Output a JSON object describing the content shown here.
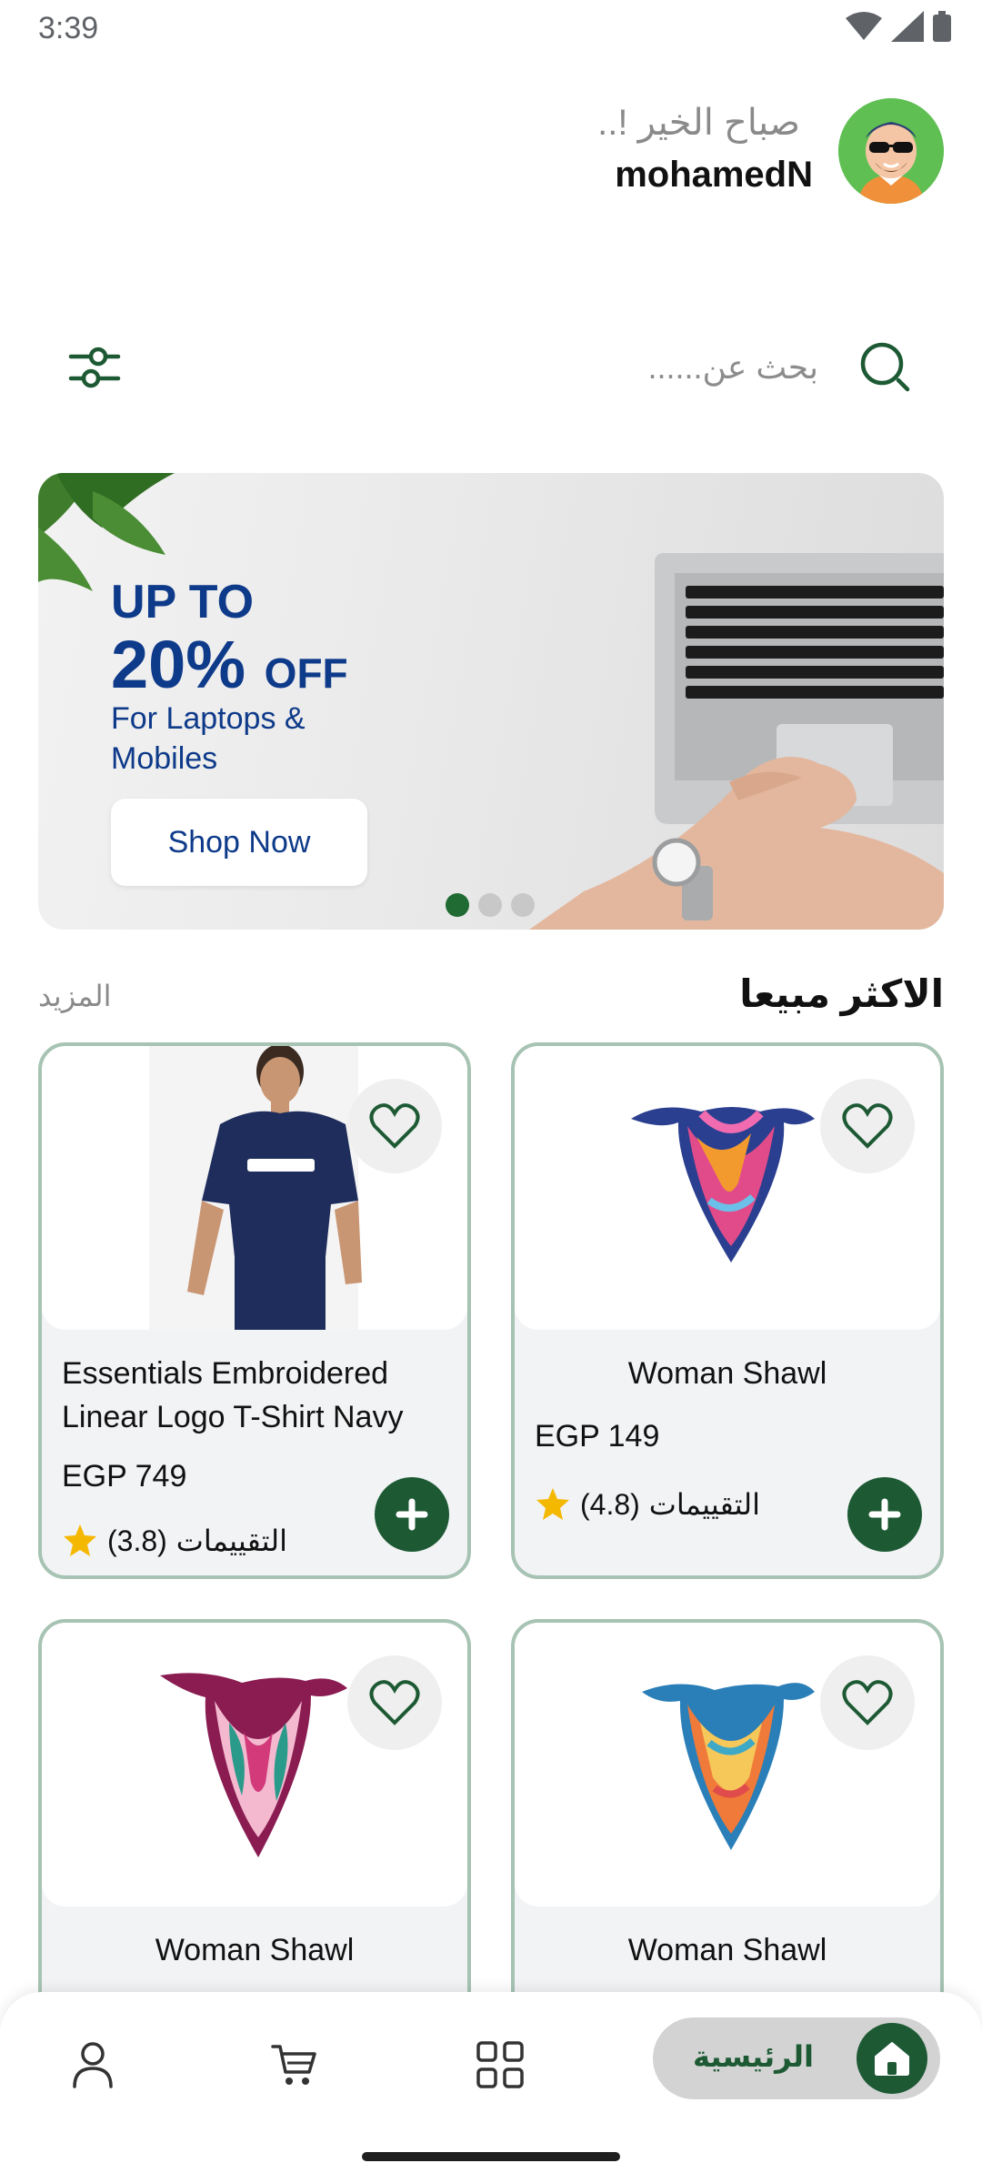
{
  "status_bar": {
    "time": "3:39"
  },
  "header": {
    "greeting": "صباح الخير !..",
    "username": "mohamedN"
  },
  "search": {
    "placeholder": "بحث عن......"
  },
  "banner": {
    "line1": "UP TO",
    "line2_percent": "20%",
    "line2_off": "OFF",
    "line3": "For Laptops & Mobiles",
    "button_label": "Shop Now",
    "slide_count": 3,
    "active_slide": 1
  },
  "section": {
    "title": "الاكثر مبيعا",
    "more_label": "المزيد"
  },
  "products": [
    {
      "name": "Woman Shawl",
      "price": "EGP 149",
      "rating": "(4.8)",
      "rating_label": "التقييمات"
    },
    {
      "name": "Essentials Embroidered Linear Logo T-Shirt Navy",
      "price": "EGP 749",
      "rating": "(3.8)",
      "rating_label": "التقييمات"
    },
    {
      "name": "Woman Shawl"
    },
    {
      "name": "Woman Shawl"
    }
  ],
  "bottom_nav": {
    "home_label": "الرئيسية"
  },
  "colors": {
    "primary": "#1d5a34",
    "card_border": "#a6c3b3",
    "banner_text": "#0e3a8a"
  }
}
